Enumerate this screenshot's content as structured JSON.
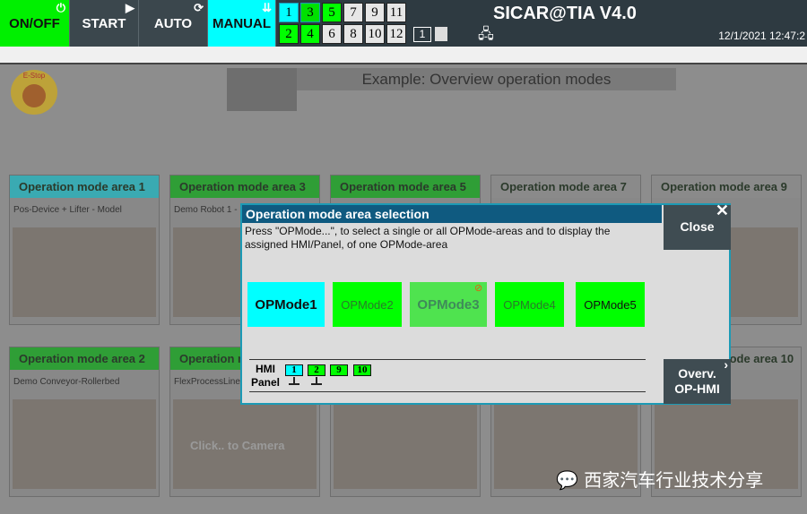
{
  "topbar": {
    "on_off": "ON/OFF",
    "start": "START",
    "auto": "AUTO",
    "manual": "MANUAL",
    "areas": [
      {
        "n": "1",
        "c": "#00ffff"
      },
      {
        "n": "3",
        "c": "#00e000"
      },
      {
        "n": "5",
        "c": "#00ff00"
      },
      {
        "n": "7",
        "c": "#e6e6e6"
      },
      {
        "n": "9",
        "c": "#e6e6e6"
      },
      {
        "n": "11",
        "c": "#e6e6e6"
      },
      {
        "n": "2",
        "c": "#00ff00"
      },
      {
        "n": "4",
        "c": "#00ff00"
      },
      {
        "n": "6",
        "c": "#e6e6e6"
      },
      {
        "n": "8",
        "c": "#e6e6e6"
      },
      {
        "n": "10",
        "c": "#e6e6e6"
      },
      {
        "n": "12",
        "c": "#e6e6e6"
      }
    ],
    "panel_no": "1",
    "title": "SICAR@TIA V4.0",
    "datetime": "12/1/2021 12:47:2"
  },
  "estop": "E-Stop",
  "example_title": "Example: Overview operation modes",
  "cards": [
    {
      "title": "Operation mode area 1",
      "sub": "Pos-Device + Lifter - Model",
      "hc": "#3aaab2"
    },
    {
      "title": "Operation mode area 3",
      "sub": "Demo Robot 1 -",
      "hc": "#2f9e36"
    },
    {
      "title": "Operation mode area 5",
      "sub": "",
      "hc": "#2f9e36"
    },
    {
      "title": "Operation mode area 7",
      "sub": "",
      "hc": "#8a8a8a"
    },
    {
      "title": "Operation mode area 9",
      "sub": "",
      "hc": "#8a8a8a"
    },
    {
      "title": "Operation mode area 2",
      "sub": "Demo Conveyor-Rollerbed",
      "hc": "#2f9e36"
    },
    {
      "title": "Operation mode area 4",
      "sub": "FlexProcessLine",
      "hc": "#2f9e36"
    },
    {
      "title": "",
      "sub": "",
      "hc": "#8a8a8a"
    },
    {
      "title": "",
      "sub": "",
      "hc": "#8a8a8a"
    },
    {
      "title": "Operation mode area 10",
      "sub": "",
      "hc": "#8a8a8a"
    }
  ],
  "camera_hint": "Click.. to Camera",
  "dialog": {
    "title": "Operation mode area selection",
    "text": "Press \"OPMode...\", to select a single or all OPMode-areas and to display the assigned HMI/Panel, of one OPMode-area",
    "close": "Close",
    "opmodes": [
      {
        "label": "OPMode1",
        "c": "#00ffff"
      },
      {
        "label": "OPMode2",
        "c": "#00ff00"
      },
      {
        "label": "OPMode3",
        "c": "#4fe34f"
      },
      {
        "label": "OPMode4",
        "c": "#00ff00"
      },
      {
        "label": "OPMode5",
        "c": "#00ff00"
      }
    ],
    "hmi_label_1": "HMI",
    "hmi_label_2": "Panel",
    "panels": [
      {
        "n": "1",
        "c": "#00ffff"
      },
      {
        "n": "2",
        "c": "#00ff00"
      },
      {
        "n": "9",
        "c": "#00ff00"
      },
      {
        "n": "10",
        "c": "#00ff00"
      }
    ],
    "overv_1": "Overv.",
    "overv_2": "OP-HMI"
  },
  "watermark": "西家汽车行业技术分享"
}
